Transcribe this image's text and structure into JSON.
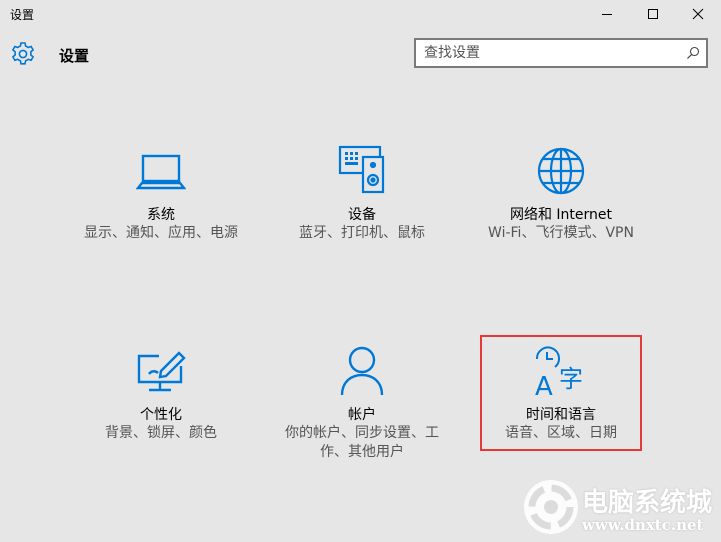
{
  "window": {
    "title": "设置",
    "controls": [
      "minimize-icon",
      "maximize-icon",
      "close-icon"
    ]
  },
  "header": {
    "title": "设置",
    "icon": "gear-icon"
  },
  "search": {
    "placeholder": "查找设置",
    "icon": "search-icon"
  },
  "accent_color": "#0078d7",
  "highlight_color": "#e53935",
  "tiles": [
    {
      "title": "系统",
      "desc": "显示、通知、应用、电源",
      "icon": "laptop-icon"
    },
    {
      "title": "设备",
      "desc": "蓝牙、打印机、鼠标",
      "icon": "devices-icon"
    },
    {
      "title": "网络和 Internet",
      "desc": "Wi-Fi、飞行模式、VPN",
      "icon": "globe-icon"
    },
    {
      "title": "个性化",
      "desc": "背景、锁屏、颜色",
      "icon": "personalization-icon"
    },
    {
      "title": "帐户",
      "desc": "你的帐户、同步设置、工作、其他用户",
      "icon": "person-icon"
    },
    {
      "title": "时间和语言",
      "desc": "语音、区域、日期",
      "icon": "time-language-icon",
      "highlighted": true
    }
  ],
  "watermark": {
    "text": "电脑系统城",
    "url": "www.dnxtc.net"
  }
}
